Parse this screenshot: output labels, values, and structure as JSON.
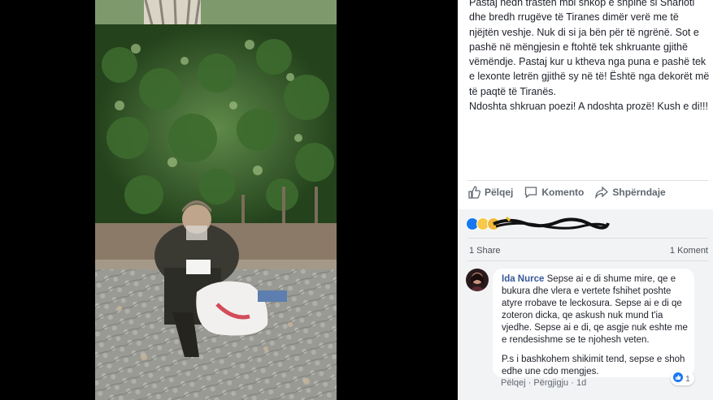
{
  "post": {
    "text_lines": [
      "Pastaj hedh trastën mbi shkop e shpinë si Sharloti dhe bredh rrugëve të Tiranes dimër verë me të njëjtën veshje. Nuk di si ja bën për të ngrënë. Sot e pashë në mëngjesin e ftohtë tek shkruante gjithë vëmëndje. Pastaj kur u ktheva nga puna e pashë tek e lexonte letrën gjithë sy në të! Është nga dekorët më të paqtë të Tiranës.",
      "Ndoshta shkruan poezi! A ndoshta prozë! Kush e di!!!"
    ]
  },
  "actions": {
    "like": "Pëlqej",
    "comment": "Komento",
    "share": "Shpërndaje"
  },
  "reactions": {
    "icons": [
      "like-icon",
      "haha-icon",
      "sad-icon"
    ],
    "share_count": "1 Share",
    "comment_count": "1 Koment"
  },
  "comment": {
    "author": "Ida Nurce",
    "text1": "Sepse ai e di shume mire, qe e bukura dhe vlera e vertete fshihet poshte atyre rrobave te leckosura. Sepse ai e di qe zoteron dicka, qe askush nuk mund t'ia vjedhe. Sepse ai e di, qe asgje nuk eshte me e rendesishme se te njohesh veten.",
    "text2": "P.s i bashkohem shikimit tend, sepse e shoh edhe une cdo mengjes.",
    "like": "Pëlqej",
    "reply": "Përgjigju",
    "time": "1d",
    "reaction_count": "1"
  },
  "colors": {
    "link": "#385898",
    "like_blue": "#1877f2",
    "panel_grey": "#f2f3f5"
  }
}
